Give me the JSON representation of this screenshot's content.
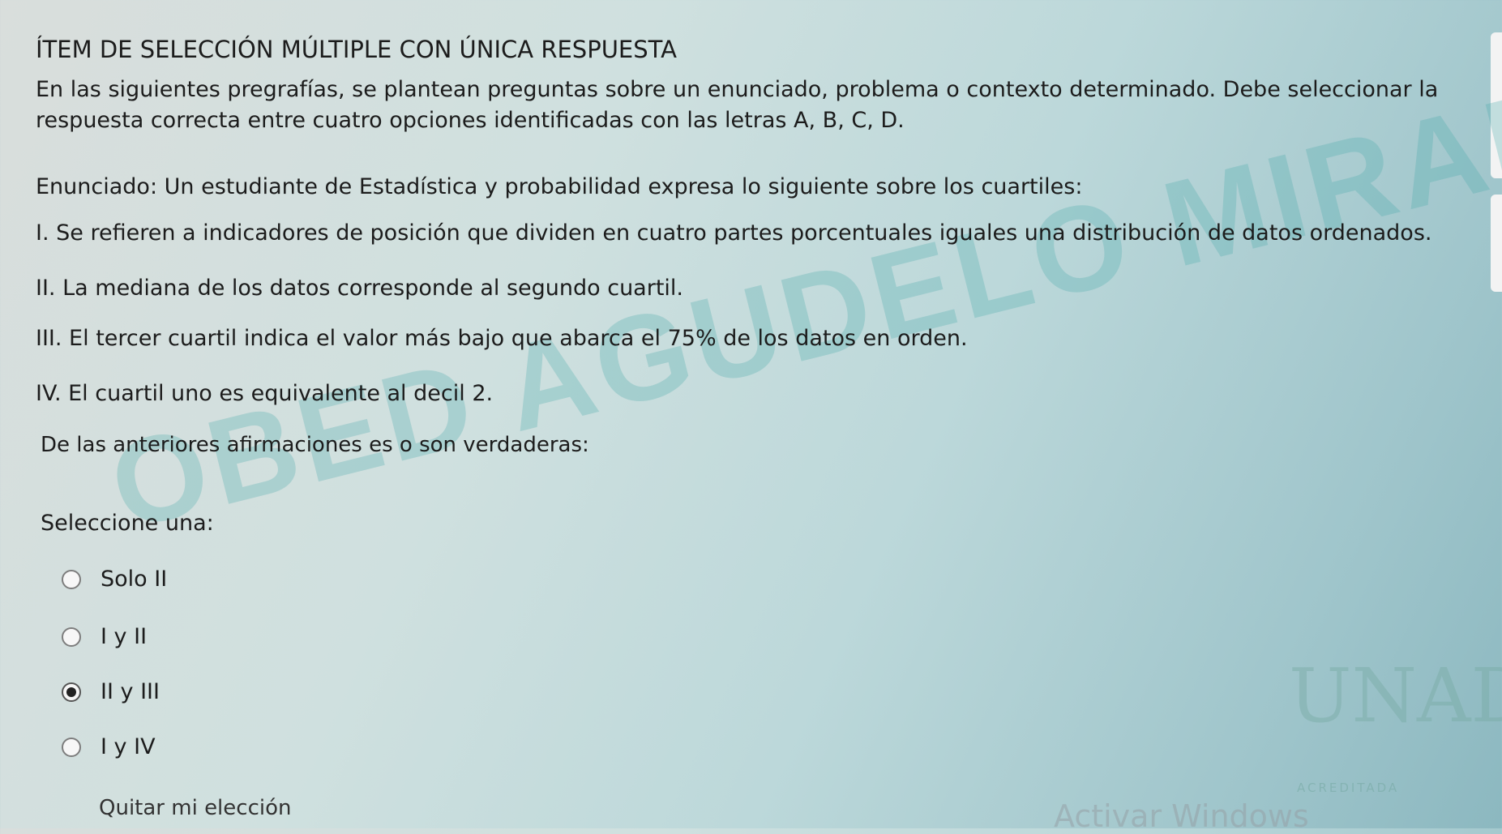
{
  "section_title": "ÍTEM DE SELECCIÓN MÚLTIPLE CON ÚNICA RESPUESTA",
  "instructions": "En las siguientes pregrafías, se plantean preguntas sobre un enunciado, problema o contexto determinado. Debe seleccionar la respuesta correcta entre cuatro opciones identificadas con las letras A, B, C, D.",
  "statement": "Enunciado: Un estudiante de Estadística y probabilidad expresa lo siguiente sobre los cuartiles:",
  "items": [
    "I. Se refieren a indicadores de posición que dividen en cuatro partes porcentuales iguales una distribución de datos ordenados.",
    "II. La mediana de los datos corresponde al segundo cuartil.",
    "III. El tercer cuartil indica el valor más bajo que abarca el 75% de los datos en orden.",
    "IV. El cuartil uno es equivalente al decil 2."
  ],
  "question": "De las anteriores afirmaciones es o son verdaderas:",
  "select_label": "Seleccione una:",
  "options": [
    {
      "label": "Solo II",
      "selected": false
    },
    {
      "label": "I y II",
      "selected": false
    },
    {
      "label": "II y III",
      "selected": true
    },
    {
      "label": "I y IV",
      "selected": false
    }
  ],
  "clear_choice": "Quitar mi elección",
  "watermark": "OBED AGUDELO MIRANDA",
  "logo_text": "UNAD",
  "logo_sub": "ACREDITADA",
  "os_overlay": "Activar Windows"
}
